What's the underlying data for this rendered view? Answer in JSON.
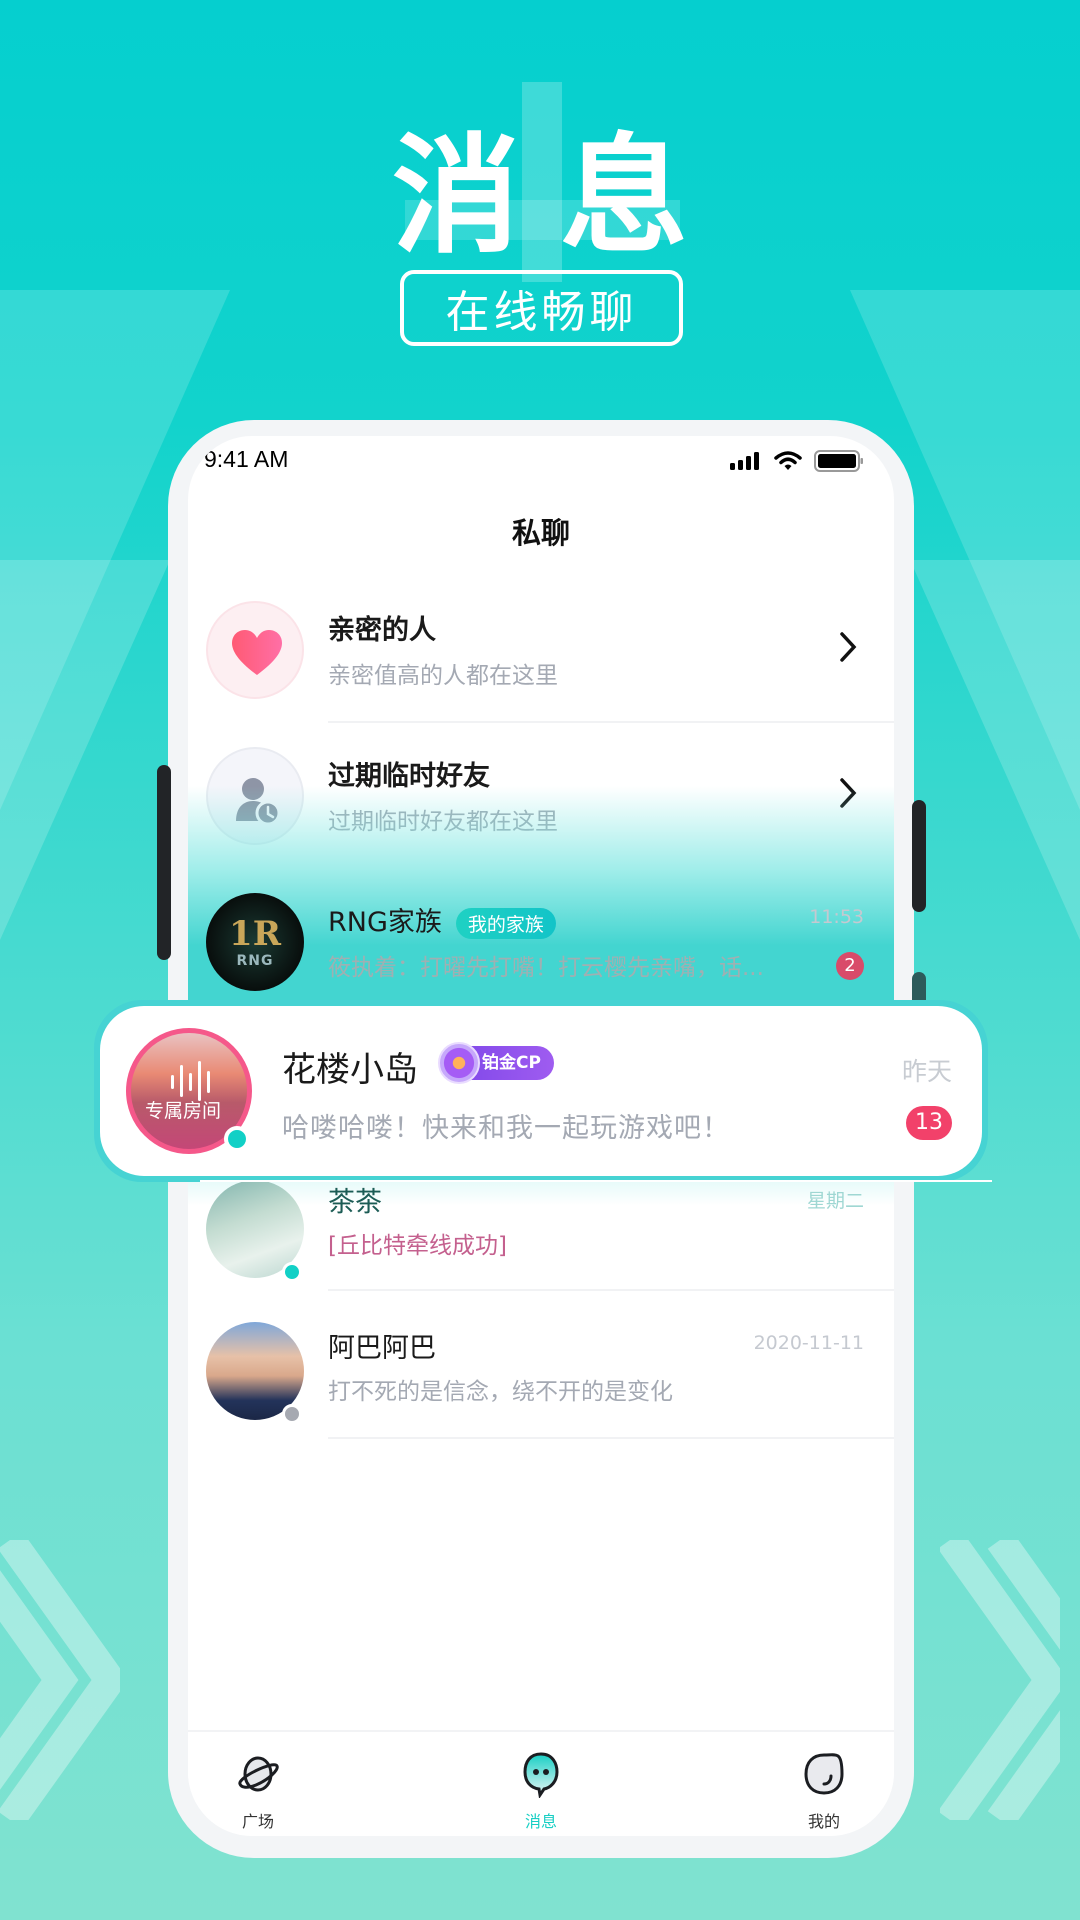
{
  "hero": {
    "title": "消息",
    "subtitle": "在线畅聊"
  },
  "status_bar": {
    "time": "9:41 AM",
    "icons": [
      "signal-icon",
      "wifi-icon",
      "battery-icon"
    ]
  },
  "header": {
    "title": "私聊"
  },
  "shortcuts": [
    {
      "icon": "heart-icon",
      "title": "亲密的人",
      "subtitle": "亲密值高的人都在这里"
    },
    {
      "icon": "expired-friend-icon",
      "title": "过期临时好友",
      "subtitle": "过期临时好友都在这里"
    }
  ],
  "conversations": [
    {
      "name": "RNG家族",
      "tag": "我的家族",
      "time": "11:53",
      "preview": "筱执着：打曜先打嘴！打云樱先亲嘴，话...",
      "unread": "2",
      "avatar": "rng-logo"
    },
    {
      "name": "花楼小岛",
      "badge": "铂金CP",
      "time": "昨天",
      "preview": "哈喽哈喽！快来和我一起玩游戏吧！",
      "unread": "13",
      "avatar_overlay": "专属房间",
      "online": true
    },
    {
      "name": "茶茶",
      "time": "星期二",
      "preview": "[丘比特牵线成功]",
      "online": true
    },
    {
      "name": "阿巴阿巴",
      "time": "2020-11-11",
      "preview": "打不死的是信念，绕不开的是变化",
      "online": false
    }
  ],
  "tabbar": {
    "tabs": [
      {
        "label": "广场",
        "icon": "planet-icon",
        "active": false
      },
      {
        "label": "消息",
        "icon": "chat-bubble-icon",
        "active": true
      },
      {
        "label": "我的",
        "icon": "profile-icon",
        "active": false
      }
    ]
  },
  "colors": {
    "accent": "#18cfc4",
    "unread": "#f2416a",
    "badge_purple": "#7b45e8",
    "background_top": "#05cfcf",
    "background_bottom": "#80e2d0"
  }
}
